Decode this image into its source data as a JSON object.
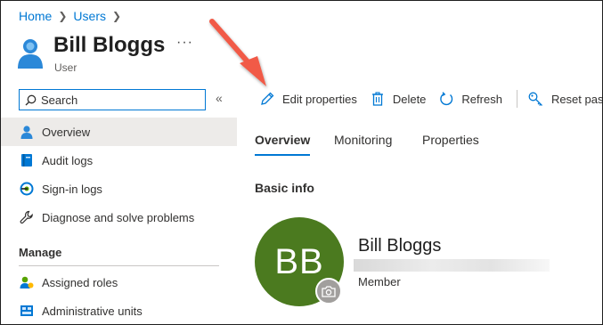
{
  "breadcrumb": {
    "home": "Home",
    "users": "Users"
  },
  "header": {
    "title": "Bill Bloggs",
    "subtitle": "User",
    "more": "···"
  },
  "search": {
    "placeholder": "Search",
    "collapse": "«"
  },
  "sidebar": {
    "items": [
      {
        "label": "Overview",
        "icon": "user-icon",
        "active": true
      },
      {
        "label": "Audit logs",
        "icon": "book-icon"
      },
      {
        "label": "Sign-in logs",
        "icon": "sign-in-icon"
      },
      {
        "label": "Diagnose and solve problems",
        "icon": "wrench-icon"
      }
    ],
    "section_manage": "Manage",
    "manage_items": [
      {
        "label": "Assigned roles",
        "icon": "roles-icon"
      },
      {
        "label": "Administrative units",
        "icon": "admin-units-icon"
      }
    ]
  },
  "toolbar": {
    "edit": "Edit properties",
    "delete": "Delete",
    "refresh": "Refresh",
    "reset": "Reset pas"
  },
  "tabs": [
    "Overview",
    "Monitoring",
    "Properties"
  ],
  "section": {
    "basic_info": "Basic info"
  },
  "profile": {
    "initials": "BB",
    "name": "Bill Bloggs",
    "role": "Member"
  },
  "colors": {
    "accent": "#0078d4",
    "avatar": "#4b7a1f",
    "arrow": "#f15a47"
  }
}
